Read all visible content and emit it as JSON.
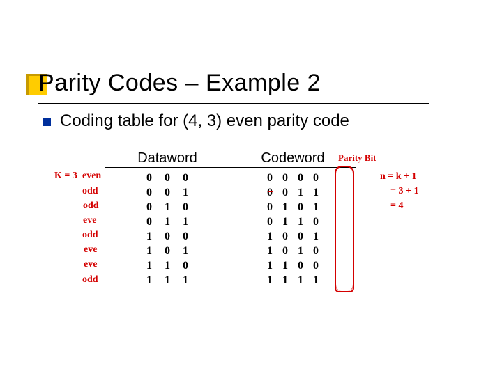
{
  "title": "Parity Codes – Example 2",
  "subtitle": "Coding table for (4, 3) even parity code",
  "headers": {
    "dataword": "Dataword",
    "codeword": "Codeword"
  },
  "rows": [
    {
      "d": [
        "0",
        "0",
        "0"
      ],
      "c": [
        "0",
        "0",
        "0",
        "0"
      ]
    },
    {
      "d": [
        "0",
        "0",
        "1"
      ],
      "c": [
        "0",
        "0",
        "1",
        "1"
      ]
    },
    {
      "d": [
        "0",
        "1",
        "0"
      ],
      "c": [
        "0",
        "1",
        "0",
        "1"
      ]
    },
    {
      "d": [
        "0",
        "1",
        "1"
      ],
      "c": [
        "0",
        "1",
        "1",
        "0"
      ]
    },
    {
      "d": [
        "1",
        "0",
        "0"
      ],
      "c": [
        "1",
        "0",
        "0",
        "1"
      ]
    },
    {
      "d": [
        "1",
        "0",
        "1"
      ],
      "c": [
        "1",
        "0",
        "1",
        "0"
      ]
    },
    {
      "d": [
        "1",
        "1",
        "0"
      ],
      "c": [
        "1",
        "1",
        "0",
        "0"
      ]
    },
    {
      "d": [
        "1",
        "1",
        "1"
      ],
      "c": [
        "1",
        "1",
        "1",
        "1"
      ]
    }
  ],
  "annotations": {
    "k_eq": "K = 3",
    "row_parities": [
      "even",
      "odd",
      "odd",
      "eve",
      "odd",
      "eve",
      "eve",
      "odd"
    ],
    "parity_bit_label": "Parity Bit",
    "n_eq_line1": "n = k + 1",
    "n_eq_line2": "= 3 + 1",
    "n_eq_line3": "= 4"
  }
}
